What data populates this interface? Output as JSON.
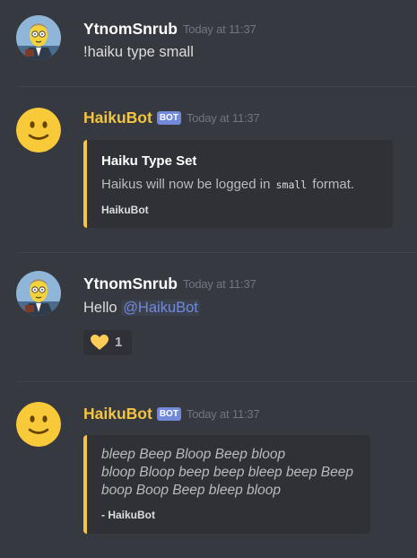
{
  "colors": {
    "background": "#36393f",
    "embed_background": "#2f3136",
    "embed_accent": "#f4c542",
    "bot_name": "#f4c542",
    "bot_tag": "#7289da",
    "mention": "#7289da",
    "timestamp": "#72767d"
  },
  "messages": [
    {
      "author": "YtnomSnrub",
      "avatar_icon": "user-avatar-icon",
      "timestamp": "Today at 11:37",
      "text": "!haiku type small"
    },
    {
      "author": "HaikuBot",
      "avatar_icon": "slight-smile-emoji-icon",
      "bot_tag": "BOT",
      "timestamp": "Today at 11:37",
      "embed": {
        "title": "Haiku Type Set",
        "desc_before": "Haikus will now be logged in ",
        "desc_code": "small",
        "desc_after": " format.",
        "footer": "HaikuBot"
      }
    },
    {
      "author": "YtnomSnrub",
      "avatar_icon": "user-avatar-icon",
      "timestamp": "Today at 11:37",
      "text": "Hello ",
      "mention": "@HaikuBot",
      "reaction": {
        "emoji": "yellow-heart-icon",
        "count": "1"
      }
    },
    {
      "author": "HaikuBot",
      "avatar_icon": "slight-smile-emoji-icon",
      "bot_tag": "BOT",
      "timestamp": "Today at 11:37",
      "embed": {
        "lines": [
          "bleep Beep Bloop Beep bloop",
          "bloop Bloop beep beep bleep beep Beep",
          "boop Boop Beep bleep bloop"
        ],
        "footer": "- HaikuBot"
      }
    }
  ]
}
